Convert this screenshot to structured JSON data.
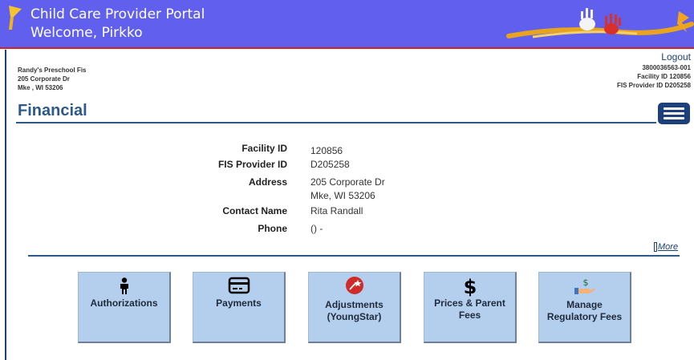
{
  "banner": {
    "title": "Child Care Provider Portal",
    "welcome": "Welcome, Pirkko"
  },
  "provider": {
    "name": "Randy's Preschool Fis",
    "street": "205 Corporate Dr",
    "city": "Mke , WI 53206"
  },
  "account": {
    "logout": "Logout",
    "provider_number": "3800036563-001",
    "facility_id": "Facility ID 120856",
    "fis_provider_id": "FIS Provider ID D205258"
  },
  "page": {
    "title": "Financial"
  },
  "details": [
    {
      "label": "Facility ID",
      "value": "120856"
    },
    {
      "label": "FIS Provider ID",
      "value": "D205258"
    },
    {
      "label": "Address",
      "value": "205 Corporate Dr",
      "value2": "Mke, WI 53206"
    },
    {
      "label": "Contact Name",
      "value": "Rita Randall"
    },
    {
      "label": "Phone",
      "value": "() -"
    }
  ],
  "more_label": "More",
  "tiles": [
    {
      "label": "Authorizations",
      "icon": "person-icon"
    },
    {
      "label": "Payments",
      "icon": "credit-card-icon"
    },
    {
      "label": "Adjustments (YoungStar)",
      "icon": "youngstar-icon"
    },
    {
      "label": "Prices & Parent Fees",
      "icon": "dollar-icon"
    },
    {
      "label": "Manage Regulatory Fees",
      "icon": "hand-money-icon"
    }
  ],
  "colors": {
    "banner": "#6160ee",
    "banner_rule": "#c6262e",
    "heading": "#2d5a8a",
    "tile": "#b4ceee",
    "menu": "#1d3f7a"
  }
}
